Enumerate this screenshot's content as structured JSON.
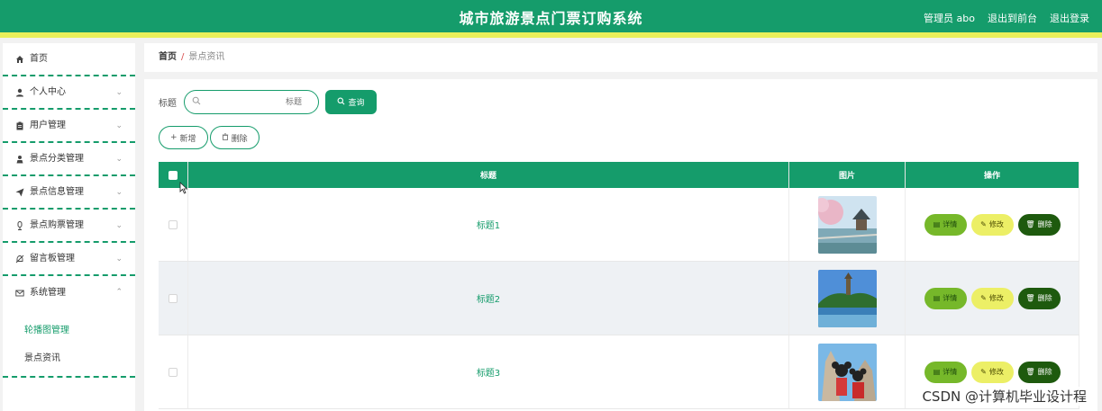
{
  "header": {
    "title": "城市旅游景点门票订购系统",
    "user": "管理员 abo",
    "to_front": "退出到前台",
    "logout": "退出登录"
  },
  "sidebar": {
    "items": [
      {
        "label": "首页",
        "icon": "home-icon",
        "expandable": false
      },
      {
        "label": "个人中心",
        "icon": "user-icon",
        "expandable": true
      },
      {
        "label": "用户管理",
        "icon": "clipboard-icon",
        "expandable": true
      },
      {
        "label": "景点分类管理",
        "icon": "person-icon",
        "expandable": true
      },
      {
        "label": "景点信息管理",
        "icon": "send-icon",
        "expandable": true
      },
      {
        "label": "景点购票管理",
        "icon": "mic-icon",
        "expandable": true
      },
      {
        "label": "留言板管理",
        "icon": "bell-off-icon",
        "expandable": true
      },
      {
        "label": "系统管理",
        "icon": "mail-icon",
        "expandable": true,
        "expanded": true
      }
    ],
    "sub_items": [
      {
        "label": "轮播图管理"
      },
      {
        "label": "景点资讯"
      }
    ]
  },
  "breadcrumb": {
    "home": "首页",
    "separator": "/",
    "current": "景点资讯"
  },
  "search": {
    "label": "标题",
    "placeholder": "标题",
    "button": "查询"
  },
  "actions": {
    "add": "新增",
    "delete": "删除"
  },
  "table": {
    "headers": {
      "title": "标题",
      "image": "图片",
      "ops": "操作"
    },
    "rows": [
      {
        "title": "标题1"
      },
      {
        "title": "标题2"
      },
      {
        "title": "标题3"
      }
    ],
    "op_labels": {
      "detail": "详情",
      "edit": "修改",
      "delete": "删除"
    }
  },
  "watermark": "CSDN @计算机毕业设计程",
  "colors": {
    "primary": "#159c6b",
    "accent_strip": "#e9ef5b",
    "detail_btn": "#76b82a",
    "edit_btn": "#ecef66",
    "delete_btn": "#1e5a0e"
  }
}
